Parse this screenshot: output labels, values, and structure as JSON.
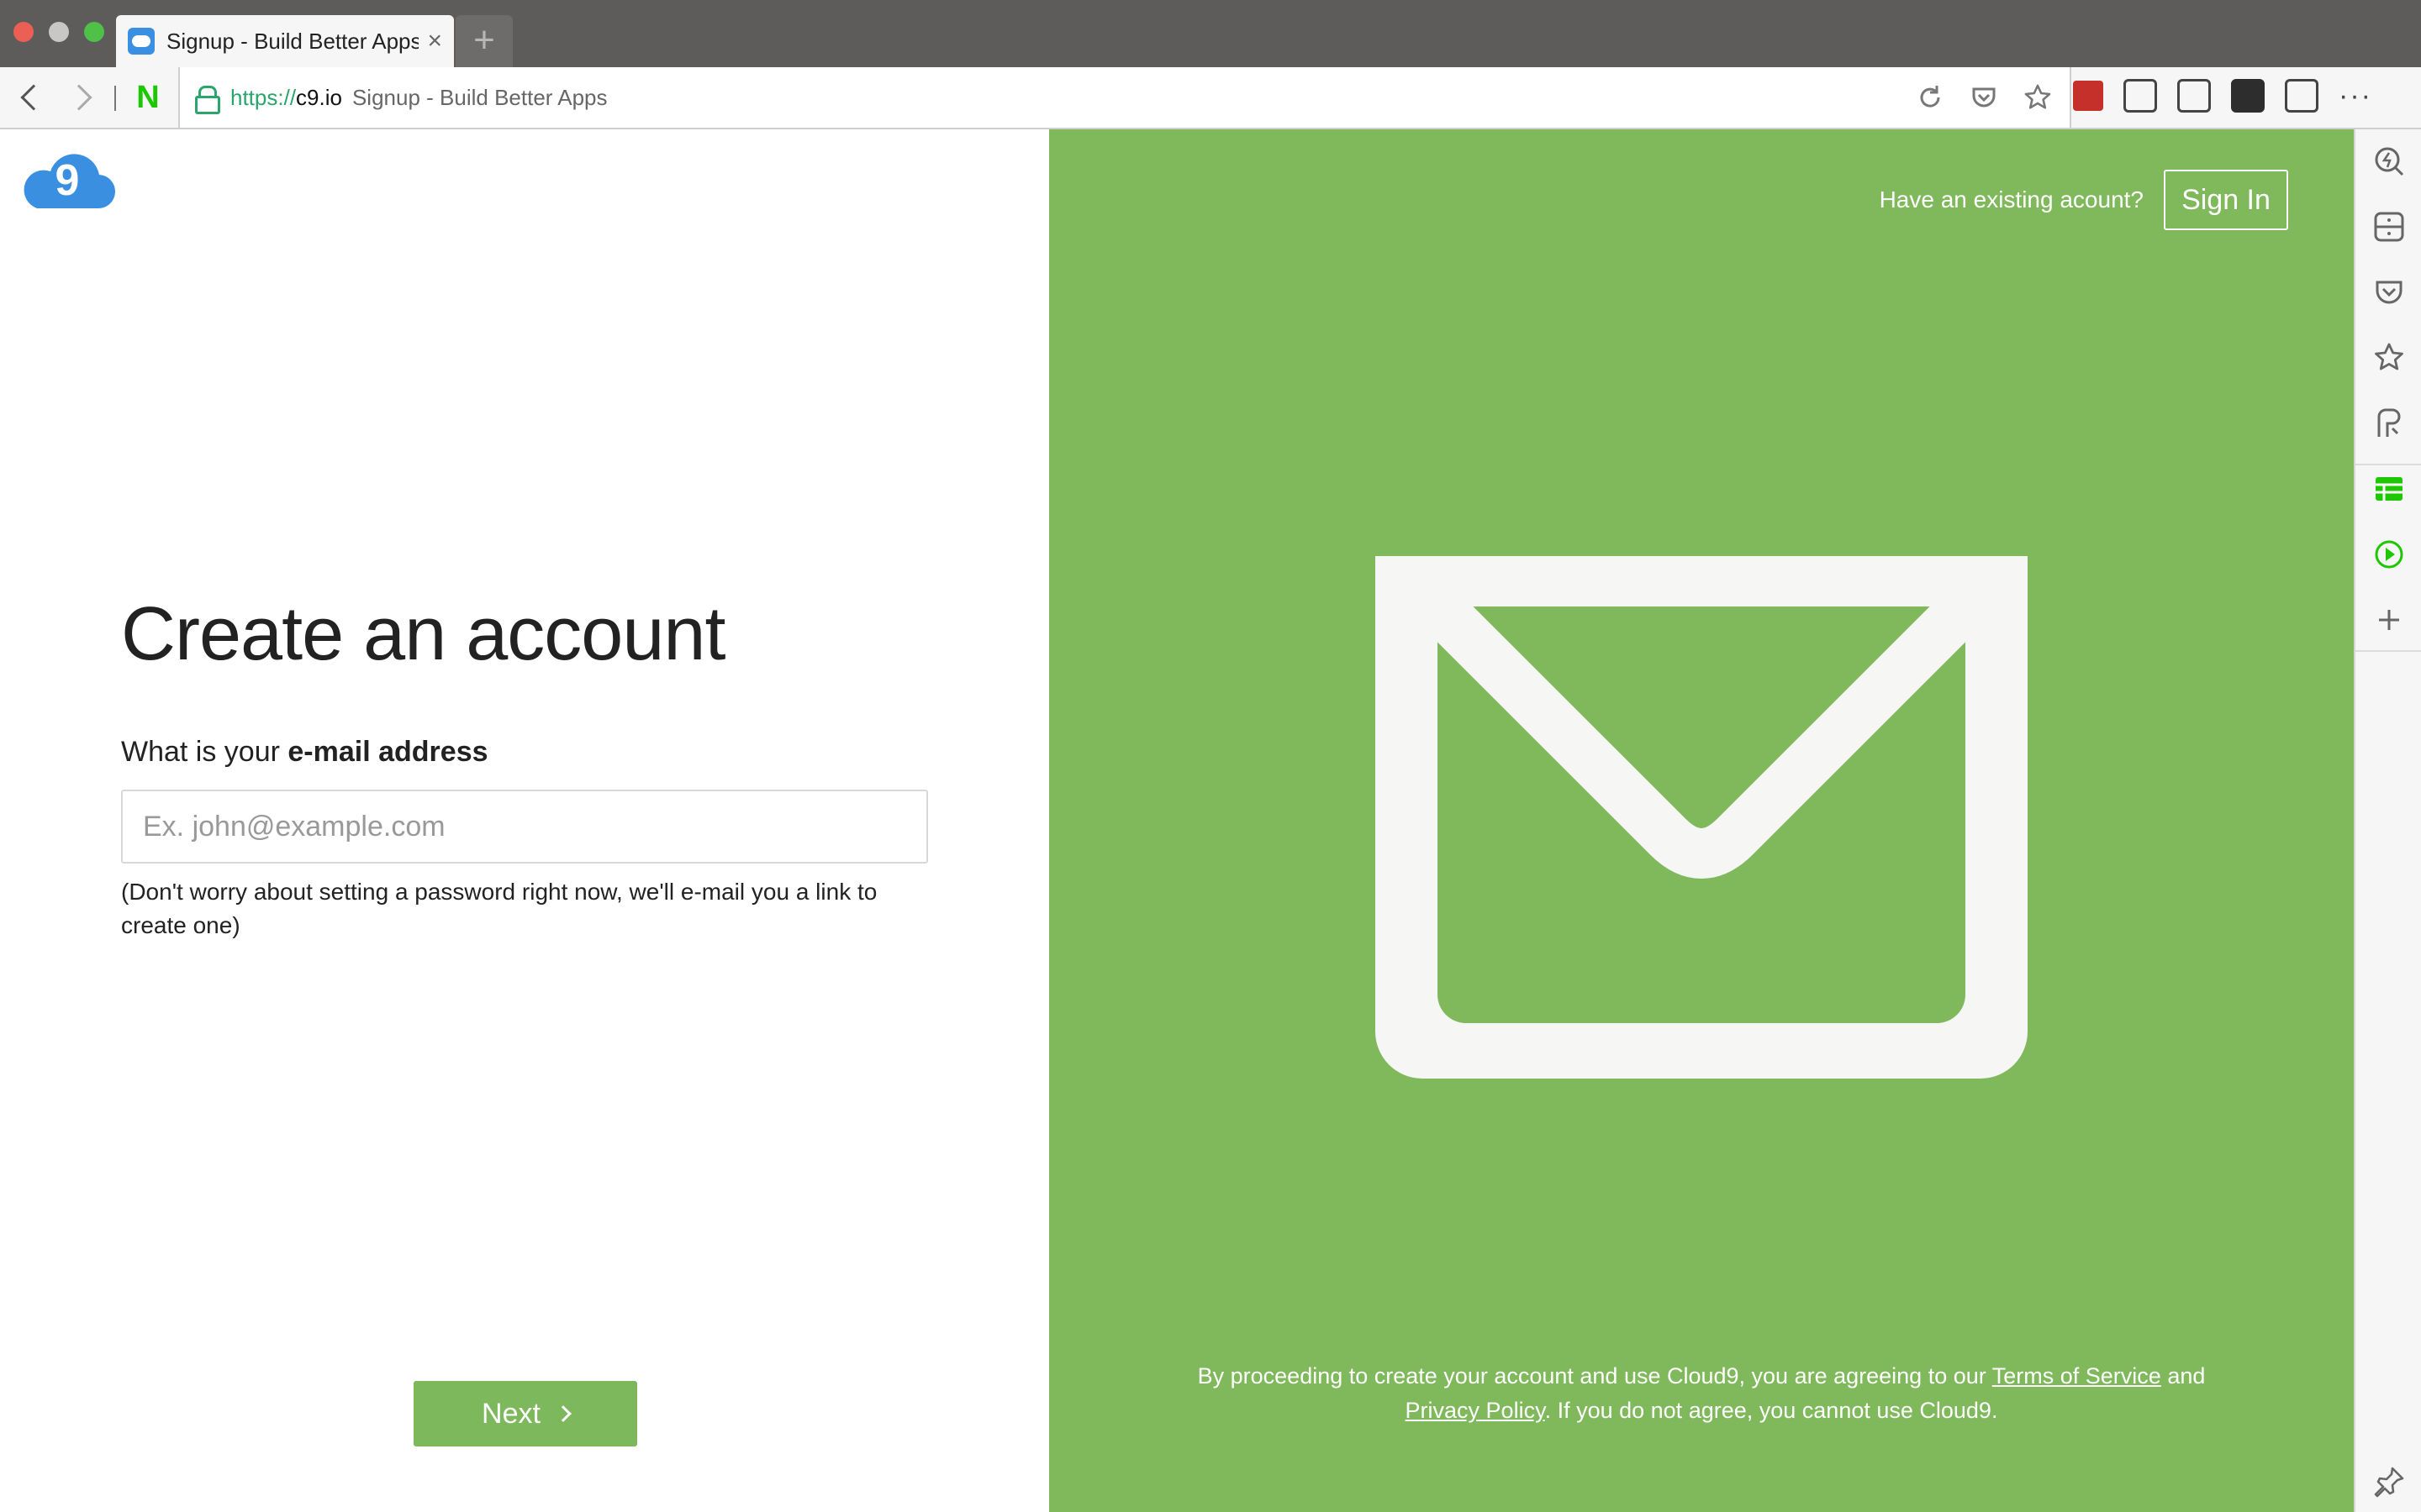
{
  "browser": {
    "tab": {
      "title": "Signup - Build Better Apps",
      "close": "×"
    },
    "new_tab": "+",
    "address": {
      "scheme": "https://",
      "host": "c9.io",
      "page_title": "Signup - Build Better Apps"
    },
    "naver_label": "N",
    "menu_dots": "···"
  },
  "page": {
    "heading": "Create an account",
    "question_prefix": "What is your ",
    "question_bold": "e-mail address",
    "email": {
      "value": "",
      "placeholder": "Ex. john@example.com"
    },
    "hint": "(Don't worry about setting a password right now, we'll e-mail you a link to create one)",
    "next_label": "Next",
    "have_account": "Have an existing acount?",
    "signin_label": "Sign In",
    "legal": {
      "before": "By proceeding to create your account and use Cloud9, you are agreeing to our ",
      "terms": "Terms of Service",
      "middle": " and ",
      "privacy": "Privacy Policy",
      "after": ". If you do not agree, you cannot use Cloud9."
    },
    "logo_digit": "9"
  },
  "colors": {
    "brand_green": "#7fb95b",
    "cloud_blue": "#3b8fe0",
    "secure_green": "#2aa56b"
  }
}
